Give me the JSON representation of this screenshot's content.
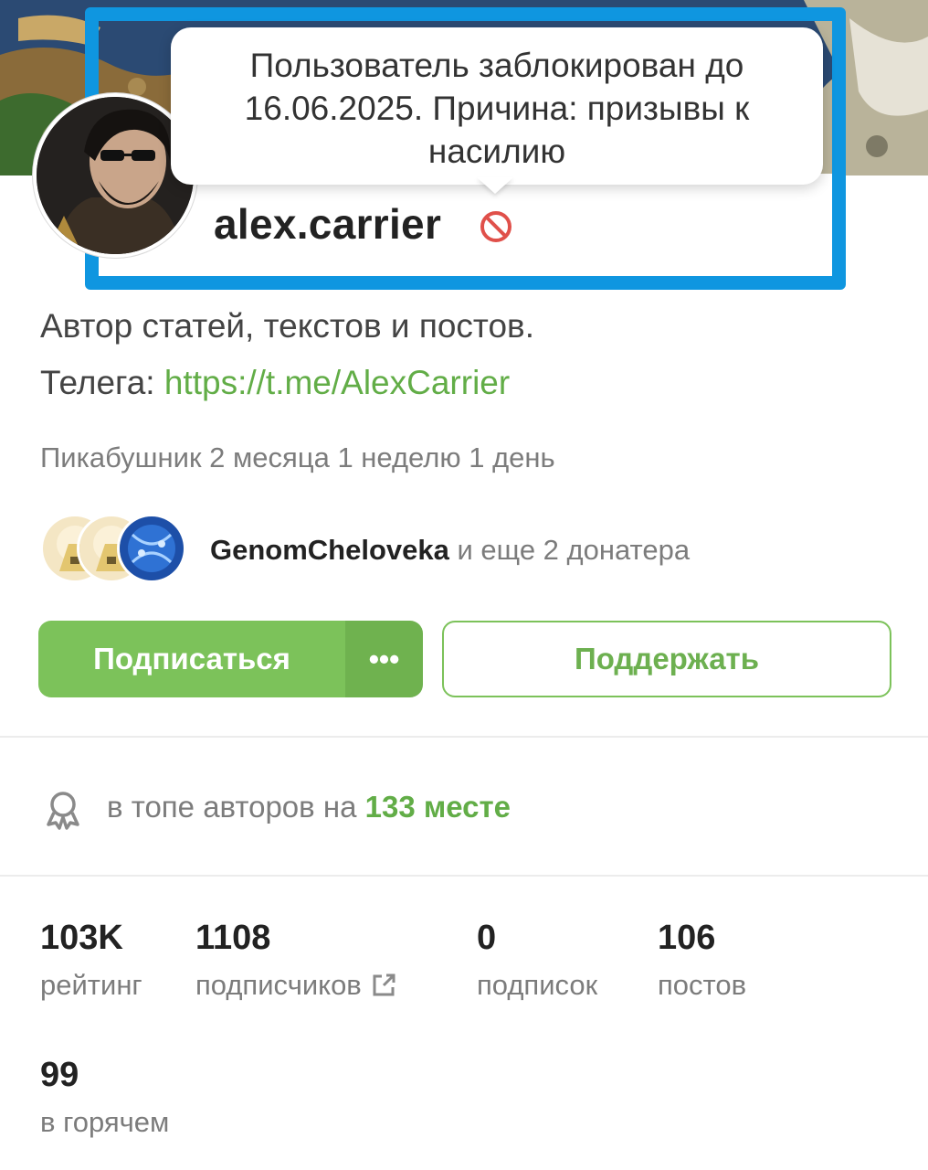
{
  "profile": {
    "username": "alex.carrier",
    "ban_tooltip": {
      "line1": "Пользователь заблокирован до",
      "line2": "16.06.2025. Причина: призывы к",
      "line3": "насилию"
    },
    "bio_line1": "Автор статей, текстов и постов.",
    "bio_line2_prefix": "Телега: ",
    "bio_link": "https://t.me/AlexCarrier",
    "age_text": "Пикабушник 2 месяца 1 неделю 1 день"
  },
  "donators": {
    "top_donor": "GenomCheloveka",
    "rest_text": " и еще 2 донатера"
  },
  "buttons": {
    "subscribe": "Подписаться",
    "more": "•••",
    "support": "Поддержать"
  },
  "top_authors": {
    "prefix": "в топе авторов на ",
    "place": "133 месте"
  },
  "stats": [
    {
      "value": "103K",
      "label": "рейтинг"
    },
    {
      "value": "1108",
      "label": "подписчиков"
    },
    {
      "value": "0",
      "label": "подписок"
    },
    {
      "value": "106",
      "label": "постов"
    },
    {
      "value": "99",
      "label": "в горячем"
    }
  ],
  "icons": {
    "banned": "banned-icon",
    "award": "award-icon",
    "external_link": "external-link-icon"
  },
  "colors": {
    "accent_green": "#7cc25a",
    "link_green": "#62ad47",
    "highlight_blue": "#0f96e0",
    "banned_red": "#e0504a"
  }
}
